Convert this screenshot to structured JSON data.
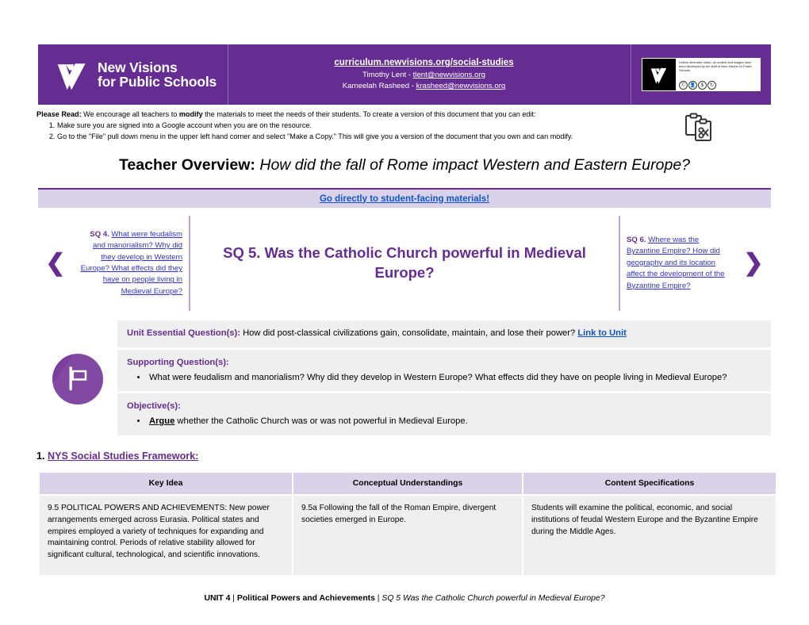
{
  "header": {
    "logo_line1": "New Visions",
    "logo_line2": "for Public Schools",
    "logo_icon": "new-visions-checkmark-logo",
    "url": "curriculum.newvisions.org/social-studies",
    "contacts": [
      {
        "name": "Timothy Lent - ",
        "email": "tlent@newvisions.org"
      },
      {
        "name": "Kameelah Rasheed - ",
        "email": "krasheed@newvisions.org"
      }
    ],
    "license": {
      "note": "Unless otherwise noted, all content and images have been developed by the staff of New Visions for Public Schools.",
      "badges": [
        "cc",
        "by",
        "nc",
        "sa"
      ]
    },
    "brand_purple": "#652D91"
  },
  "please_read": {
    "label": "Please Read:",
    "intro_before": " We encourage all teachers to ",
    "intro_bold": "modify",
    "intro_after": " the materials to meet the needs of their students. To create a version of this document that you can edit:",
    "steps": [
      "Make sure you are signed into a Google account when you are on the resource.",
      "Go to the \"File\" pull down menu in the upper left hand corner and select \"Make a Copy.\" This will give you a version of the document that you own and can modify."
    ],
    "copy_icon": "copy-clipboard-icon"
  },
  "title": {
    "prefix": "Teacher Overview:",
    "question": "How did the fall of Rome impact Western and Eastern Europe?"
  },
  "subbar": {
    "link": "Go directly to student-facing materials!",
    "background": "#D9D2E9",
    "link_color": "#1155CC"
  },
  "nav": {
    "prev_arrow": "❮",
    "next_arrow": "❯",
    "prev": {
      "label": "SQ 4.",
      "text": "What were feudalism and manorialism? Why did they develop in Western Europe? What effects did they have on people living in Medieval Europe?"
    },
    "current": "SQ 5. Was the Catholic Church powerful in Medieval Europe?",
    "next": {
      "label": "SQ 6.",
      "text": "Where was the Byzantine Empire? How did geography and its location affect the development of the Byzantine Empire?"
    }
  },
  "question_block": {
    "flag_icon": "flag-banner-icon",
    "essential": {
      "label": "Unit Essential Question(s):",
      "text": " How did post-classical civilizations gain, consolidate, maintain, and lose their power? ",
      "link": "Link to Unit"
    },
    "supporting": {
      "label": "Supporting Question(s):",
      "bullets": [
        "What were feudalism and manorialism? Why did they develop in Western Europe? What effects did they have on people living in Medieval Europe?"
      ]
    },
    "objectives": {
      "label": "Objective(s):",
      "bullets": [
        {
          "verb": "Argue",
          "rest": " whether the Catholic Church was or was not powerful in Medieval Europe."
        }
      ]
    }
  },
  "framework": {
    "number": "1. ",
    "heading": "NYS Social Studies Framework:",
    "columns": [
      "Key Idea",
      "Conceptual Understandings",
      "Content Specifications"
    ],
    "rows": [
      {
        "key_idea": "9.5 POLITICAL POWERS AND ACHIEVEMENTS: New power arrangements emerged across Eurasia. Political states and empires employed a variety of techniques for expanding and maintaining control. Periods of relative stability allowed for significant cultural, technological, and scientific innovations.",
        "conceptual": "9.5a Following the fall of the Roman Empire, divergent societies emerged in Europe.",
        "content": "Students will examine the political, economic, and social institutions of feudal Western Europe and the Byzantine Empire during the Middle Ages."
      }
    ]
  },
  "footer": {
    "unit": "UNIT 4",
    "sep1": " | ",
    "unit_name": "Political Powers and Achievements",
    "sep2": " | ",
    "sq": "SQ 5 Was the Catholic Church powerful in Medieval Europe?"
  }
}
